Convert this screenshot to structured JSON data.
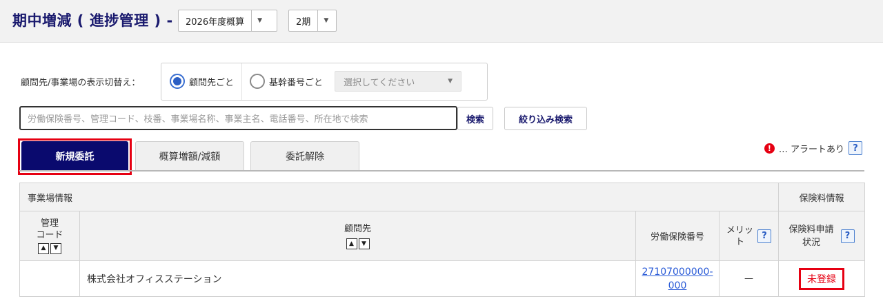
{
  "header": {
    "title": "期中増減 ( 進捗管理 ) -",
    "fiscal_select": "2026年度概算",
    "period_select": "2期"
  },
  "display_switch": {
    "label": "顧問先/事業場の表示切替え：",
    "option_client": "顧問先ごと",
    "option_base_number": "基幹番号ごと",
    "select_placeholder": "選択してください"
  },
  "search": {
    "placeholder": "労働保険番号、管理コード、枝番、事業場名称、事業主名、電話番号、所在地で検索",
    "search_button": "検索",
    "filter_button": "絞り込み検索"
  },
  "tabs": [
    {
      "label": "新規委託",
      "active": true
    },
    {
      "label": "概算増額/減額",
      "active": false
    },
    {
      "label": "委託解除",
      "active": false
    }
  ],
  "legend": {
    "alert_icon": "!",
    "alert_text": "… アラートあり",
    "help": "?"
  },
  "table": {
    "group_office": "事業場情報",
    "group_premium": "保険料情報",
    "columns": {
      "code_line1": "管理",
      "code_line2": "コード",
      "client": "顧問先",
      "insurance_no": "労働保険番号",
      "merit_line1": "メリッ",
      "merit_line2": "ト",
      "status_line1": "保険料申請",
      "status_line2": "状況"
    },
    "rows": [
      {
        "code": "",
        "client": "株式会社オフィスステーション",
        "insurance_no_line1": "27107000000-",
        "insurance_no_line2": "000",
        "merit": "—",
        "status": "未登録"
      }
    ]
  },
  "colors": {
    "brand_navy": "#0a0a6e",
    "title_navy": "#1a1a6e",
    "highlight_red": "#e60012",
    "link_blue": "#2a5bd7"
  }
}
